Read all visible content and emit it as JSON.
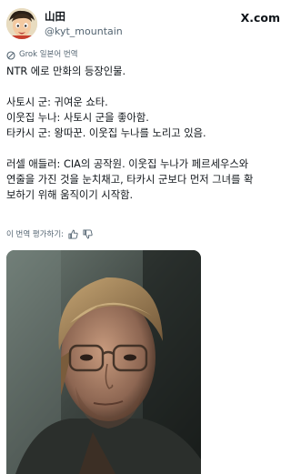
{
  "post": {
    "author_name": "山田",
    "author_handle": "@kyt_mountain",
    "brand": "X.com",
    "translation_note": "Grok 일본어 번역",
    "lines": [
      "NTR 에로 만화의 등장인물.",
      "",
      "사토시 군: 귀여운 쇼타.",
      "이웃집 누나: 사토시 군을 좋아함.",
      "타카시 군: 왕따꾼. 이웃집 누나를 노리고 있음.",
      "",
      "러셀 애들러: CIA의 공작원. 이웃집 누나가 페르세우스와",
      "연줄을 가진 것을 눈치채고, 타카시 군보다 먼저 그녀를 확",
      "보하기 위해 움직이기 시작함."
    ],
    "rate_translation": "이 번역 평가하기:"
  },
  "icons": {
    "grok": "grok-icon",
    "x_logo": "x-logo-icon",
    "thumbs_up": "thumbs-up-icon",
    "thumbs_down": "thumbs-down-icon"
  },
  "colors": {
    "text": "#0f1419",
    "secondary": "#536471",
    "background": "#ffffff"
  }
}
